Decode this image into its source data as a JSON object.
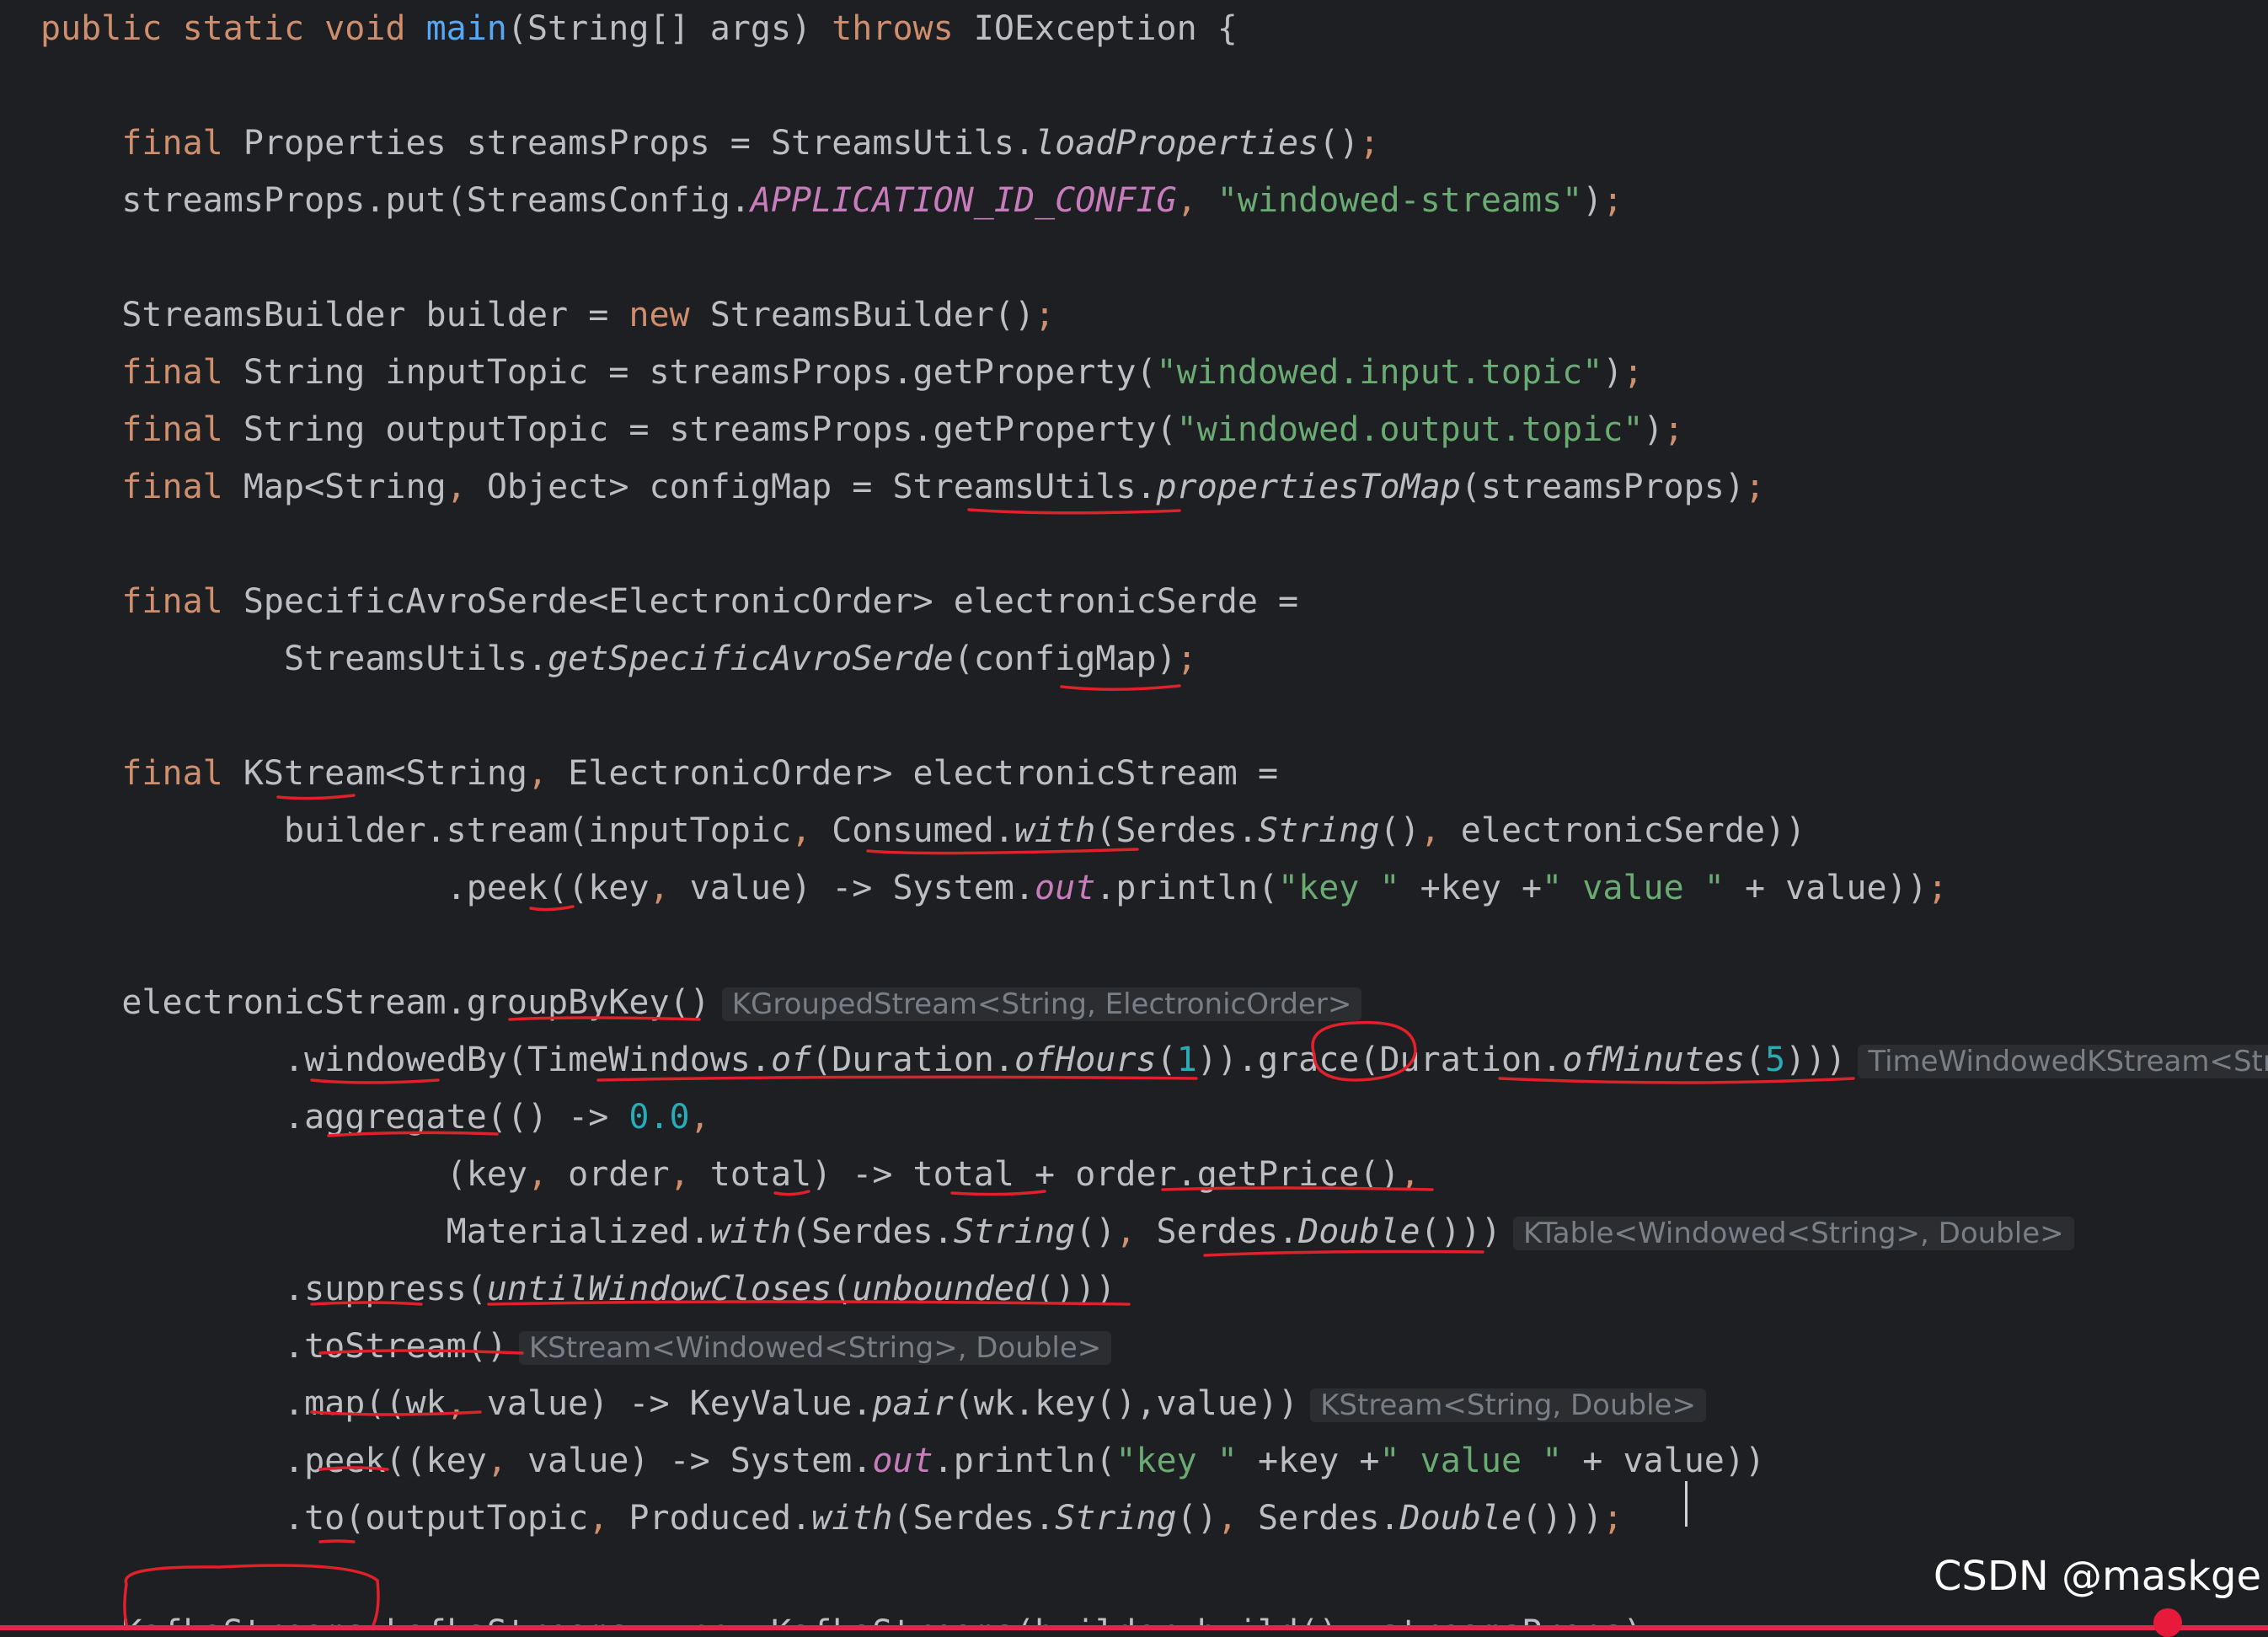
{
  "editor": {
    "theme_colors": {
      "background": "#1e1f22",
      "keyword": "#cf8e6d",
      "string": "#6aab73",
      "static_member": "#c77dbb",
      "number": "#2aacb8",
      "inlay_hint": "#7a7e85",
      "annotation_ink": "#e0202a"
    },
    "lines": [
      [
        {
          "t": "public static void ",
          "c": "kw"
        },
        {
          "t": "main",
          "c": "fn"
        },
        {
          "t": "(String[] args) ",
          "c": "pn"
        },
        {
          "t": "throws ",
          "c": "kw"
        },
        {
          "t": "IOException {",
          "c": "pn"
        }
      ],
      [],
      [
        {
          "t": "    "
        },
        {
          "t": "final ",
          "c": "kw"
        },
        {
          "t": "Properties streamsProps = StreamsUtils.",
          "c": "pn"
        },
        {
          "t": "loadProperties",
          "c": "it"
        },
        {
          "t": "()",
          "c": "pn"
        },
        {
          "t": ";",
          "c": "kw"
        }
      ],
      [
        {
          "t": "    streamsProps.put(StreamsConfig."
        },
        {
          "t": "APPLICATION_ID_CONFIG",
          "c": "cn"
        },
        {
          "t": ", ",
          "c": "kw"
        },
        {
          "t": "\"windowed-streams\"",
          "c": "st"
        },
        {
          "t": ")"
        },
        {
          "t": ";",
          "c": "kw"
        }
      ],
      [],
      [
        {
          "t": "    StreamsBuilder builder = "
        },
        {
          "t": "new ",
          "c": "kw"
        },
        {
          "t": "StreamsBuilder()"
        },
        {
          "t": ";",
          "c": "kw"
        }
      ],
      [
        {
          "t": "    "
        },
        {
          "t": "final ",
          "c": "kw"
        },
        {
          "t": "String inputTopic = streamsProps.getProperty("
        },
        {
          "t": "\"windowed.input.topic\"",
          "c": "st"
        },
        {
          "t": ")"
        },
        {
          "t": ";",
          "c": "kw"
        }
      ],
      [
        {
          "t": "    "
        },
        {
          "t": "final ",
          "c": "kw"
        },
        {
          "t": "String outputTopic = streamsProps.getProperty("
        },
        {
          "t": "\"windowed.output.topic\"",
          "c": "st"
        },
        {
          "t": ")"
        },
        {
          "t": ";",
          "c": "kw"
        }
      ],
      [
        {
          "t": "    "
        },
        {
          "t": "final ",
          "c": "kw"
        },
        {
          "t": "Map<String"
        },
        {
          "t": ", ",
          "c": "kw"
        },
        {
          "t": "Object> configMap = StreamsUtils."
        },
        {
          "t": "propertiesToMap",
          "c": "it"
        },
        {
          "t": "(streamsProps)"
        },
        {
          "t": ";",
          "c": "kw"
        }
      ],
      [],
      [
        {
          "t": "    "
        },
        {
          "t": "final ",
          "c": "kw"
        },
        {
          "t": "SpecificAvroSerde<ElectronicOrder> electronicSerde ="
        }
      ],
      [
        {
          "t": "            StreamsUtils."
        },
        {
          "t": "getSpecificAvroSerde",
          "c": "it"
        },
        {
          "t": "(configMap)"
        },
        {
          "t": ";",
          "c": "kw"
        }
      ],
      [],
      [
        {
          "t": "    "
        },
        {
          "t": "final ",
          "c": "kw"
        },
        {
          "t": "KStream<String"
        },
        {
          "t": ", ",
          "c": "kw"
        },
        {
          "t": "ElectronicOrder> electronicStream ="
        }
      ],
      [
        {
          "t": "            builder.stream(inputTopic"
        },
        {
          "t": ", ",
          "c": "kw"
        },
        {
          "t": "Consumed."
        },
        {
          "t": "with",
          "c": "it"
        },
        {
          "t": "(Serdes."
        },
        {
          "t": "String",
          "c": "it"
        },
        {
          "t": "()"
        },
        {
          "t": ", ",
          "c": "kw"
        },
        {
          "t": "electronicSerde))"
        }
      ],
      [
        {
          "t": "                    .peek((key"
        },
        {
          "t": ", ",
          "c": "kw"
        },
        {
          "t": "value) -> System."
        },
        {
          "t": "out",
          "c": "sf"
        },
        {
          "t": ".println("
        },
        {
          "t": "\"key \"",
          "c": "st"
        },
        {
          "t": " +key +"
        },
        {
          "t": "\" value \"",
          "c": "st"
        },
        {
          "t": " + value))"
        },
        {
          "t": ";",
          "c": "kw"
        }
      ],
      [],
      [
        {
          "t": "    electronicStream.groupByKey()"
        },
        {
          "t": "KGroupedStream<String, ElectronicOrder>",
          "c": "hint"
        }
      ],
      [
        {
          "t": "            .windowedBy(TimeWindows."
        },
        {
          "t": "of",
          "c": "it"
        },
        {
          "t": "(Duration."
        },
        {
          "t": "ofHours",
          "c": "it"
        },
        {
          "t": "("
        },
        {
          "t": "1",
          "c": "nm"
        },
        {
          "t": ")).grace(Duration."
        },
        {
          "t": "ofMinutes",
          "c": "it"
        },
        {
          "t": "("
        },
        {
          "t": "5",
          "c": "nm"
        },
        {
          "t": ")))"
        },
        {
          "t": "TimeWindowedKStream<String, ElectronicOrder>",
          "c": "hint"
        }
      ],
      [
        {
          "t": "            .aggregate(() -> "
        },
        {
          "t": "0.0",
          "c": "nm"
        },
        {
          "t": ",",
          "c": "kw"
        }
      ],
      [
        {
          "t": "                    (key"
        },
        {
          "t": ", ",
          "c": "kw"
        },
        {
          "t": "order"
        },
        {
          "t": ", ",
          "c": "kw"
        },
        {
          "t": "total) -> total + order.getPrice()"
        },
        {
          "t": ",",
          "c": "kw"
        }
      ],
      [
        {
          "t": "                    Materialized."
        },
        {
          "t": "with",
          "c": "it"
        },
        {
          "t": "(Serdes."
        },
        {
          "t": "String",
          "c": "it"
        },
        {
          "t": "()"
        },
        {
          "t": ", ",
          "c": "kw"
        },
        {
          "t": "Serdes."
        },
        {
          "t": "Double",
          "c": "it"
        },
        {
          "t": "()))"
        },
        {
          "t": "KTable<Windowed<String>, Double>",
          "c": "hint"
        }
      ],
      [
        {
          "t": "            .suppress("
        },
        {
          "t": "untilWindowCloses",
          "c": "it"
        },
        {
          "t": "("
        },
        {
          "t": "unbounded",
          "c": "it"
        },
        {
          "t": "()))"
        }
      ],
      [
        {
          "t": "            .toStream()"
        },
        {
          "t": "KStream<Windowed<String>, Double>",
          "c": "hint"
        }
      ],
      [
        {
          "t": "            .map((wk"
        },
        {
          "t": ", ",
          "c": "kw"
        },
        {
          "t": "value) -> KeyValue."
        },
        {
          "t": "pair",
          "c": "it"
        },
        {
          "t": "(wk.key(),value))"
        },
        {
          "t": "KStream<String, Double>",
          "c": "hint"
        }
      ],
      [
        {
          "t": "            .peek((key"
        },
        {
          "t": ", ",
          "c": "kw"
        },
        {
          "t": "value) -> System."
        },
        {
          "t": "out",
          "c": "sf"
        },
        {
          "t": ".println("
        },
        {
          "t": "\"key \"",
          "c": "st"
        },
        {
          "t": " +key +"
        },
        {
          "t": "\" value \"",
          "c": "st"
        },
        {
          "t": " + value))"
        }
      ],
      [
        {
          "t": "            .to(outputTopic"
        },
        {
          "t": ", ",
          "c": "kw"
        },
        {
          "t": "Produced."
        },
        {
          "t": "with",
          "c": "it"
        },
        {
          "t": "(Serdes."
        },
        {
          "t": "String",
          "c": "it"
        },
        {
          "t": "()"
        },
        {
          "t": ", ",
          "c": "kw"
        },
        {
          "t": "Serdes."
        },
        {
          "t": "Double",
          "c": "it"
        },
        {
          "t": "()))"
        },
        {
          "t": ";",
          "c": "kw"
        }
      ],
      [],
      [
        {
          "t": "    KafkaStreams kafkaStreams = "
        },
        {
          "t": "new ",
          "c": "kw"
        },
        {
          "t": "KafkaStreams(builder.build()"
        },
        {
          "t": ", ",
          "c": "kw"
        },
        {
          "t": "streamsProps)"
        },
        {
          "t": ";",
          "c": "kw"
        }
      ]
    ]
  },
  "watermark": "CSDN @maskge"
}
